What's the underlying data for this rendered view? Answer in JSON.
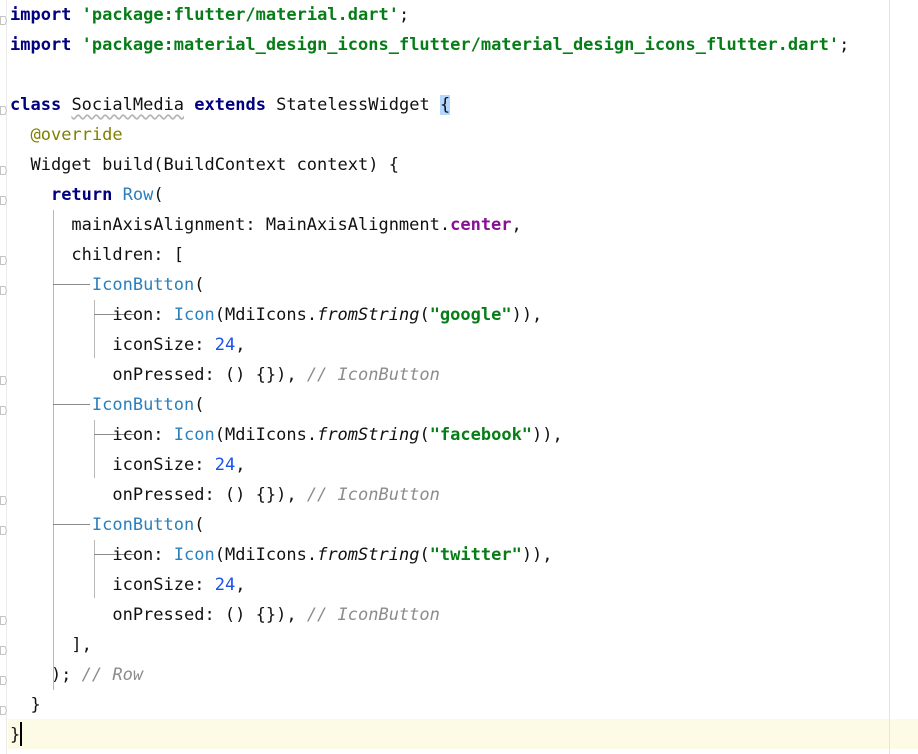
{
  "editor": {
    "lines": [
      {
        "tokens": [
          [
            "kw",
            "import"
          ],
          [
            "p",
            " "
          ],
          [
            "str",
            "'package:flutter/material.dart'"
          ],
          [
            "p",
            ";"
          ]
        ]
      },
      {
        "tokens": [
          [
            "kw",
            "import"
          ],
          [
            "p",
            " "
          ],
          [
            "str",
            "'package:material_design_icons_flutter/material_design_icons_flutter.dart'"
          ],
          [
            "p",
            ";"
          ]
        ]
      },
      {
        "tokens": []
      },
      {
        "tokens": [
          [
            "kw",
            "class"
          ],
          [
            "p",
            " "
          ],
          [
            "sq",
            "SocialMedia"
          ],
          [
            "p",
            " "
          ],
          [
            "kw",
            "extends"
          ],
          [
            "p",
            " StatelessWidget "
          ],
          [
            "brace-match",
            "{"
          ]
        ]
      },
      {
        "tokens": [
          [
            "p",
            "  "
          ],
          [
            "ann",
            "@override"
          ]
        ]
      },
      {
        "tokens": [
          [
            "p",
            "  Widget build(BuildContext context) {"
          ]
        ]
      },
      {
        "tokens": [
          [
            "p",
            "    "
          ],
          [
            "kw",
            "return"
          ],
          [
            "p",
            " "
          ],
          [
            "cls",
            "Row"
          ],
          [
            "p",
            "("
          ]
        ]
      },
      {
        "tokens": [
          [
            "p",
            "      mainAxisAlignment: MainAxisAlignment."
          ],
          [
            "fld",
            "center"
          ],
          [
            "p",
            ","
          ]
        ]
      },
      {
        "tokens": [
          [
            "p",
            "      children: ["
          ]
        ]
      },
      {
        "tokens": [
          [
            "p",
            "        "
          ],
          [
            "cls",
            "IconButton"
          ],
          [
            "p",
            "("
          ]
        ]
      },
      {
        "tokens": [
          [
            "p",
            "          icon: "
          ],
          [
            "cls",
            "Icon"
          ],
          [
            "p",
            "(MdiIcons."
          ],
          [
            "ital",
            "fromString"
          ],
          [
            "p",
            "("
          ],
          [
            "str",
            "\"google\""
          ],
          [
            "p",
            ")),"
          ]
        ]
      },
      {
        "tokens": [
          [
            "p",
            "          iconSize: "
          ],
          [
            "num",
            "24"
          ],
          [
            "p",
            ","
          ]
        ]
      },
      {
        "tokens": [
          [
            "p",
            "          onPressed: () {}), "
          ],
          [
            "cmt",
            "// IconButton"
          ]
        ]
      },
      {
        "tokens": [
          [
            "p",
            "        "
          ],
          [
            "cls",
            "IconButton"
          ],
          [
            "p",
            "("
          ]
        ]
      },
      {
        "tokens": [
          [
            "p",
            "          icon: "
          ],
          [
            "cls",
            "Icon"
          ],
          [
            "p",
            "(MdiIcons."
          ],
          [
            "ital",
            "fromString"
          ],
          [
            "p",
            "("
          ],
          [
            "str",
            "\"facebook\""
          ],
          [
            "p",
            ")),"
          ]
        ]
      },
      {
        "tokens": [
          [
            "p",
            "          iconSize: "
          ],
          [
            "num",
            "24"
          ],
          [
            "p",
            ","
          ]
        ]
      },
      {
        "tokens": [
          [
            "p",
            "          onPressed: () {}), "
          ],
          [
            "cmt",
            "// IconButton"
          ]
        ]
      },
      {
        "tokens": [
          [
            "p",
            "        "
          ],
          [
            "cls",
            "IconButton"
          ],
          [
            "p",
            "("
          ]
        ]
      },
      {
        "tokens": [
          [
            "p",
            "          icon: "
          ],
          [
            "cls",
            "Icon"
          ],
          [
            "p",
            "(MdiIcons."
          ],
          [
            "ital",
            "fromString"
          ],
          [
            "p",
            "("
          ],
          [
            "str",
            "\"twitter\""
          ],
          [
            "p",
            ")),"
          ]
        ]
      },
      {
        "tokens": [
          [
            "p",
            "          iconSize: "
          ],
          [
            "num",
            "24"
          ],
          [
            "p",
            ","
          ]
        ]
      },
      {
        "tokens": [
          [
            "p",
            "          onPressed: () {}), "
          ],
          [
            "cmt",
            "// IconButton"
          ]
        ]
      },
      {
        "tokens": [
          [
            "p",
            "      ],"
          ]
        ]
      },
      {
        "tokens": [
          [
            "p",
            "    ); "
          ],
          [
            "cmt",
            "// Row"
          ]
        ]
      },
      {
        "tokens": [
          [
            "p",
            "  }"
          ]
        ]
      },
      {
        "tokens": [
          [
            "p",
            "}"
          ]
        ]
      }
    ]
  }
}
